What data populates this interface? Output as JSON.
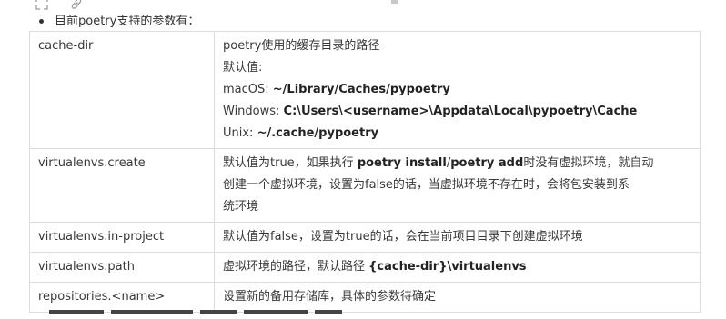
{
  "intro": {
    "text": "目前poetry支持的参数有："
  },
  "toolbar": {
    "icons": [
      "expand-icon",
      "link-icon"
    ]
  },
  "table": {
    "rows": [
      {
        "key": "cache-dir",
        "lines": [
          [
            {
              "t": "poetry使用的缓存目录的路径",
              "b": false
            }
          ],
          [
            {
              "t": "默认值:",
              "b": false
            }
          ],
          [
            {
              "t": "macOS: ",
              "b": false
            },
            {
              "t": "~/Library/Caches/pypoetry",
              "b": true
            }
          ],
          [
            {
              "t": "Windows: ",
              "b": false
            },
            {
              "t": "C:\\Users\\<username>\\Appdata\\Local\\pypoetry\\Cache",
              "b": true
            }
          ],
          [
            {
              "t": "Unix: ",
              "b": false
            },
            {
              "t": "~/.cache/pypoetry",
              "b": true
            }
          ]
        ]
      },
      {
        "key": "virtualenvs.create",
        "lines": [
          [
            {
              "t": "默认值为true，如果执行 ",
              "b": false
            },
            {
              "t": "poetry install",
              "b": true
            },
            {
              "t": "/",
              "b": false
            },
            {
              "t": "poetry add",
              "b": true
            },
            {
              "t": "时没有虚拟环境，就自动",
              "b": false
            }
          ],
          [
            {
              "t": "创建一个虚拟环境，设置为false的话，当虚拟环境不存在时，会将包安装到系",
              "b": false
            }
          ],
          [
            {
              "t": "统环境",
              "b": false
            }
          ]
        ]
      },
      {
        "key": "virtualenvs.in-project",
        "lines": [
          [
            {
              "t": "默认值为false，设置为true的话，会在当前项目目录下创建虚拟环境",
              "b": false
            }
          ]
        ]
      },
      {
        "key": "virtualenvs.path",
        "lines": [
          [
            {
              "t": "虚拟环境的路径，默认路径 ",
              "b": false
            },
            {
              "t": "{cache-dir}\\virtualenvs",
              "b": true
            }
          ]
        ]
      },
      {
        "key": "repositories.<name>",
        "lines": [
          [
            {
              "t": "设置新的备用存储库，具体的参数待确定",
              "b": false
            }
          ]
        ]
      }
    ]
  }
}
